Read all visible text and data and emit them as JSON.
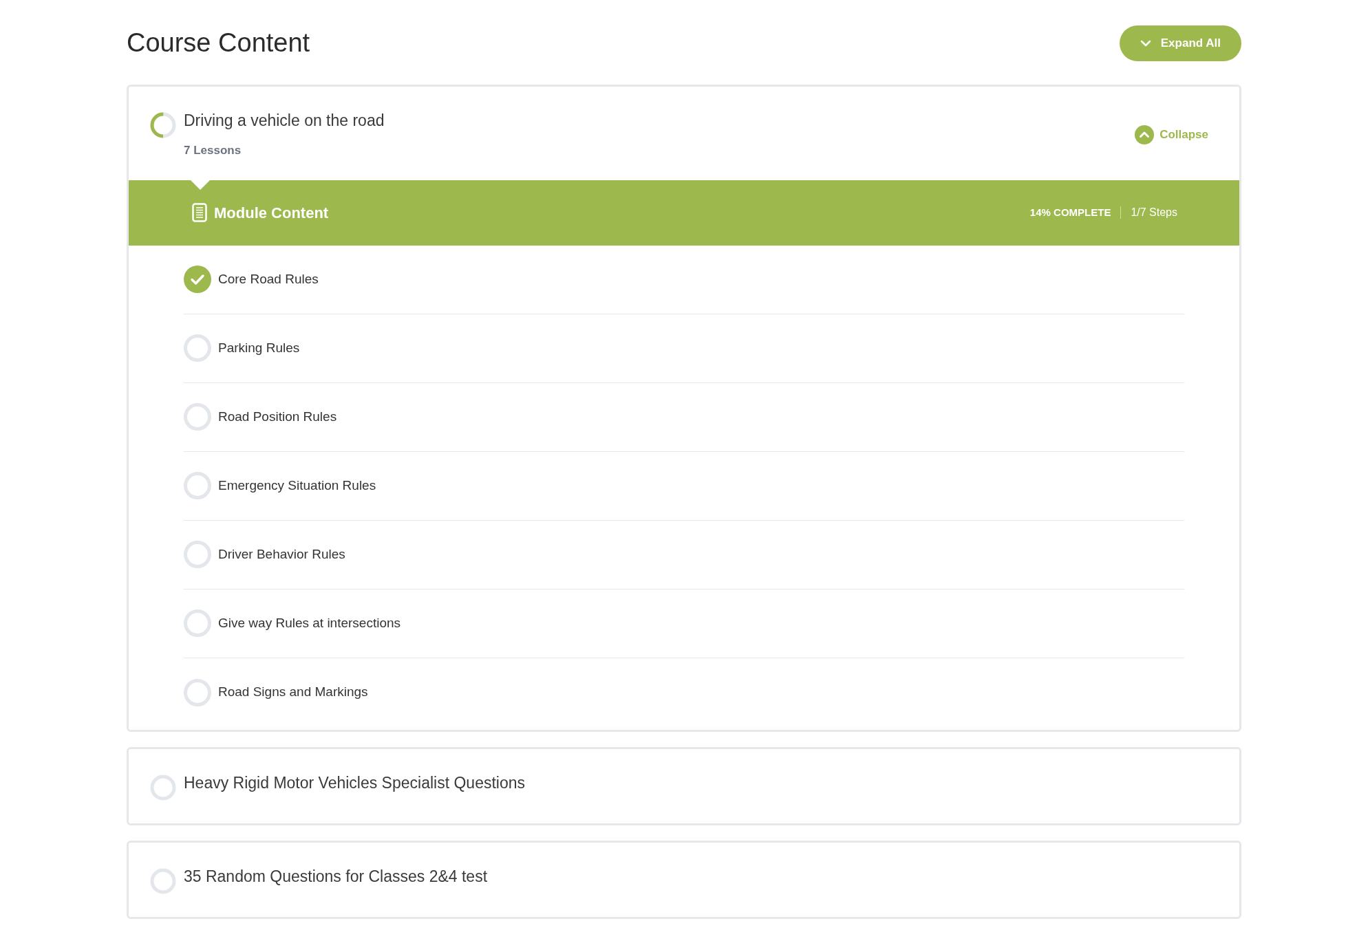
{
  "page_title": "Course Content",
  "expand_all_button": {
    "label": "Expand All"
  },
  "modules": [
    {
      "title": "Driving a vehicle on the road",
      "lessons": "7 Lessons",
      "level": 0.5,
      "expanded": true,
      "toggle_label": "Collapse",
      "content": {
        "title": "Module Content",
        "progress": "14% COMPLETE",
        "steps": "1/7 Steps",
        "lessons": [
          {
            "title": "Core Road Rules",
            "completed": true
          },
          {
            "title": "Parking Rules",
            "completed": false
          },
          {
            "title": "Road Position Rules",
            "completed": false
          },
          {
            "title": "Emergency Situation Rules",
            "completed": false
          },
          {
            "title": "Driver Behavior Rules",
            "completed": false
          },
          {
            "title": "Give way Rules at intersections",
            "completed": false
          },
          {
            "title": "Road Signs and Markings",
            "completed": false
          }
        ]
      }
    },
    {
      "title": "Heavy Rigid Motor Vehicles Specialist Questions",
      "level": 0,
      "expanded": false
    },
    {
      "title": "35 Random Questions for Classes 2&4 test",
      "level": 0,
      "expanded": false
    }
  ]
}
